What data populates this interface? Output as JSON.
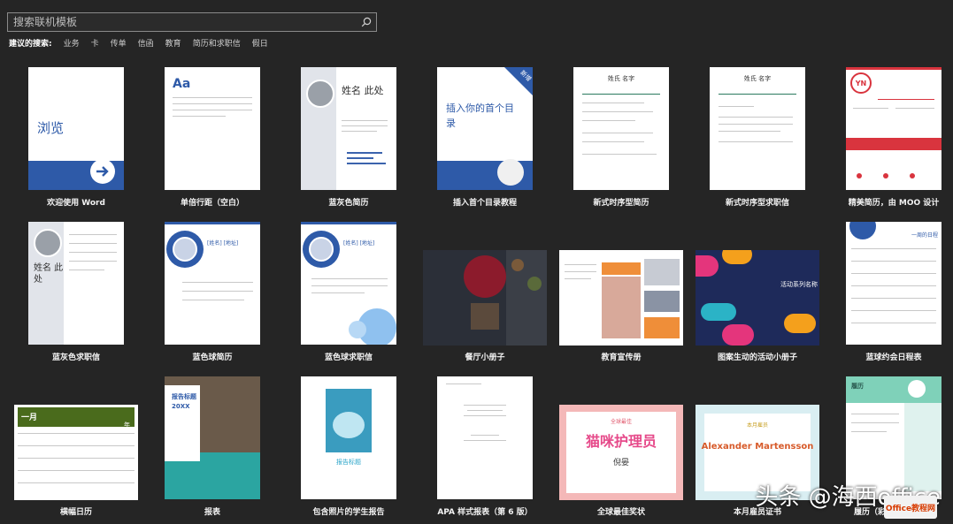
{
  "search": {
    "placeholder": "搜索联机模板"
  },
  "suggested": {
    "label": "建议的搜索:",
    "links": [
      "业务",
      "卡",
      "传单",
      "信函",
      "教育",
      "简历和求职信",
      "假日"
    ]
  },
  "templates": [
    {
      "caption": "欢迎使用 Word",
      "text": "浏览"
    },
    {
      "caption": "单倍行距（空白）",
      "text": "Aa"
    },
    {
      "caption": "蓝灰色简历",
      "text": "姓名 此处"
    },
    {
      "caption": "插入首个目录教程",
      "text": "插入你的首个目录",
      "badge": "新增"
    },
    {
      "caption": "新式时序型简历",
      "text": "姓氏 名字"
    },
    {
      "caption": "新式时序型求职信",
      "text": "姓氏 名字"
    },
    {
      "caption": "精美简历，由 MOO 设计",
      "text": "YN"
    },
    {
      "caption": "蓝灰色求职信",
      "text": "姓名 此处"
    },
    {
      "caption": "蓝色球简历",
      "text": "[姓名] [地址]"
    },
    {
      "caption": "蓝色球求职信",
      "text": "[姓名] [地址]"
    },
    {
      "caption": "餐厅小册子",
      "text": ""
    },
    {
      "caption": "教育宣传册",
      "text": ""
    },
    {
      "caption": "图案生动的活动小册子",
      "text": "活动系列名称"
    },
    {
      "caption": "蓝球约会日程表",
      "text": "一周的日程"
    },
    {
      "caption": "横幅日历",
      "text": "一月",
      "sub": "年"
    },
    {
      "caption": "报表",
      "text": "报告标题",
      "sub": "20XX"
    },
    {
      "caption": "包含照片的学生报告",
      "text": "报告标题"
    },
    {
      "caption": "APA 样式报表（第 6 版）",
      "text": ""
    },
    {
      "caption": "全球最佳奖状",
      "text": "猫咪护理员",
      "sub": "倪晏",
      "badge": "全球最佳"
    },
    {
      "caption": "本月雇员证书",
      "text": "Alexander Martensson",
      "badge": "本月雇员"
    },
    {
      "caption": "履历（彩色编码设计）",
      "text": "履历"
    }
  ],
  "watermark": {
    "text": "头条 @海西office",
    "logo": "Office教程网"
  },
  "colors": {
    "background": "#252525",
    "accent": "#2e5aa8",
    "red": "#d9343e"
  }
}
